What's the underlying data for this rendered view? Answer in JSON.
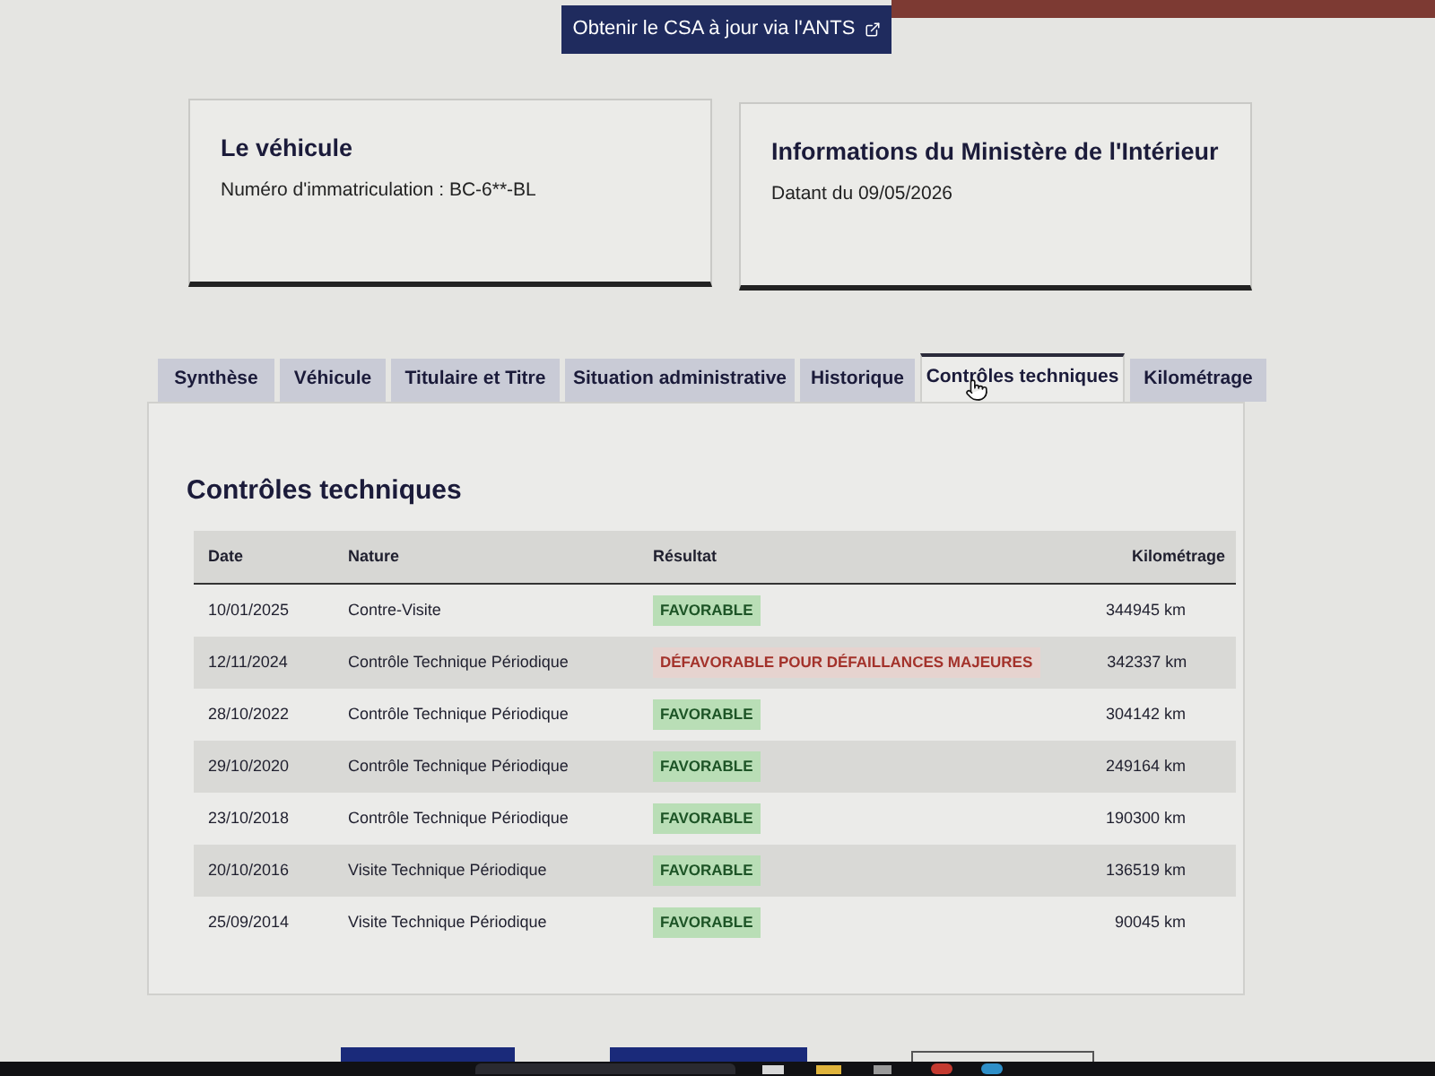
{
  "header_link": {
    "label": "Obtenir le CSA à jour via l'ANTS"
  },
  "cards": [
    {
      "title": "Le véhicule",
      "text": "Numéro d'immatriculation : BC-6**-BL"
    },
    {
      "title": "Informations du Ministère de l'Intérieur",
      "text": "Datant du 09/05/2026"
    }
  ],
  "tabs": [
    {
      "label": "Synthèse",
      "selected": false
    },
    {
      "label": "Véhicule",
      "selected": false
    },
    {
      "label": "Titulaire et Titre",
      "selected": false
    },
    {
      "label": "Situation administrative",
      "selected": false
    },
    {
      "label": "Historique",
      "selected": false
    },
    {
      "label": "Contrôles techniques",
      "selected": true
    },
    {
      "label": "Kilométrage",
      "selected": false
    }
  ],
  "panel": {
    "title": "Contrôles techniques",
    "table": {
      "columns": [
        "Date",
        "Nature",
        "Résultat",
        "Kilométrage"
      ],
      "rows": [
        {
          "date": "10/01/2025",
          "nature": "Contre-Visite",
          "result": {
            "label": "FAVORABLE",
            "kind": "favorable"
          },
          "mileage": "344945 km"
        },
        {
          "date": "12/11/2024",
          "nature": "Contrôle Technique Périodique",
          "result": {
            "label": "DÉFAVORABLE POUR DÉFAILLANCES MAJEURES",
            "kind": "unfavorable"
          },
          "mileage": "342337 km"
        },
        {
          "date": "28/10/2022",
          "nature": "Contrôle Technique Périodique",
          "result": {
            "label": "FAVORABLE",
            "kind": "favorable"
          },
          "mileage": "304142 km"
        },
        {
          "date": "29/10/2020",
          "nature": "Contrôle Technique Périodique",
          "result": {
            "label": "FAVORABLE",
            "kind": "favorable"
          },
          "mileage": "249164 km"
        },
        {
          "date": "23/10/2018",
          "nature": "Contrôle Technique Périodique",
          "result": {
            "label": "FAVORABLE",
            "kind": "favorable"
          },
          "mileage": "190300 km"
        },
        {
          "date": "20/10/2016",
          "nature": "Visite Technique Périodique",
          "result": {
            "label": "FAVORABLE",
            "kind": "favorable"
          },
          "mileage": "136519 km"
        },
        {
          "date": "25/09/2014",
          "nature": "Visite Technique Périodique",
          "result": {
            "label": "FAVORABLE",
            "kind": "favorable"
          },
          "mileage": "90045 km"
        }
      ]
    }
  }
}
